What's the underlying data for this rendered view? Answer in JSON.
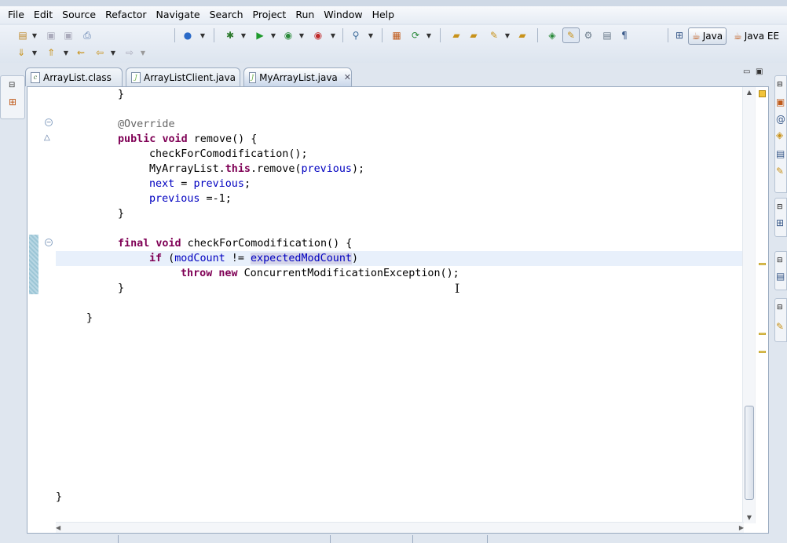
{
  "menu": [
    "File",
    "Edit",
    "Source",
    "Refactor",
    "Navigate",
    "Search",
    "Project",
    "Run",
    "Window",
    "Help"
  ],
  "perspectives": [
    {
      "label": "Java",
      "icon": "java-perspective-icon",
      "active": true
    },
    {
      "label": "Java EE",
      "icon": "javaee-perspective-icon",
      "active": false
    }
  ],
  "tabs": [
    {
      "label": "ArrayList.class",
      "icon": "class-file-icon",
      "active": false
    },
    {
      "label": "ArrayListClient.java",
      "icon": "java-file-icon",
      "active": false
    },
    {
      "label": "MyArrayList.java",
      "icon": "java-file-icon",
      "active": true,
      "closable": true
    }
  ],
  "code": {
    "l1": "}",
    "l3": "@Override",
    "l4_kw1": "public",
    "l4_kw2": "void",
    "l4_rest": " remove() {",
    "l5": "checkForComodification();",
    "l6_a": "MyArrayList.",
    "l6_kw": "this",
    "l6_b": ".remove(",
    "l6_fld": "previous",
    "l6_c": ");",
    "l7_f1": "next",
    "l7_eq": " = ",
    "l7_f2": "previous",
    "l7_end": ";",
    "l8_f": "previous",
    "l8_rest": " =-1;",
    "l9": "}",
    "l11_kw1": "final",
    "l11_kw2": "void",
    "l11_rest": " checkForComodification() {",
    "l12_kw": "if",
    "l12_a": " (",
    "l12_f1": "modCount",
    "l12_op": " != ",
    "l12_f2": "expectedModCount",
    "l12_end": ")",
    "l13_kw1": "throw",
    "l13_kw2": "new",
    "l13_rest": " ConcurrentModificationException();",
    "l14": "}",
    "l16": "}",
    "l27": "}"
  }
}
